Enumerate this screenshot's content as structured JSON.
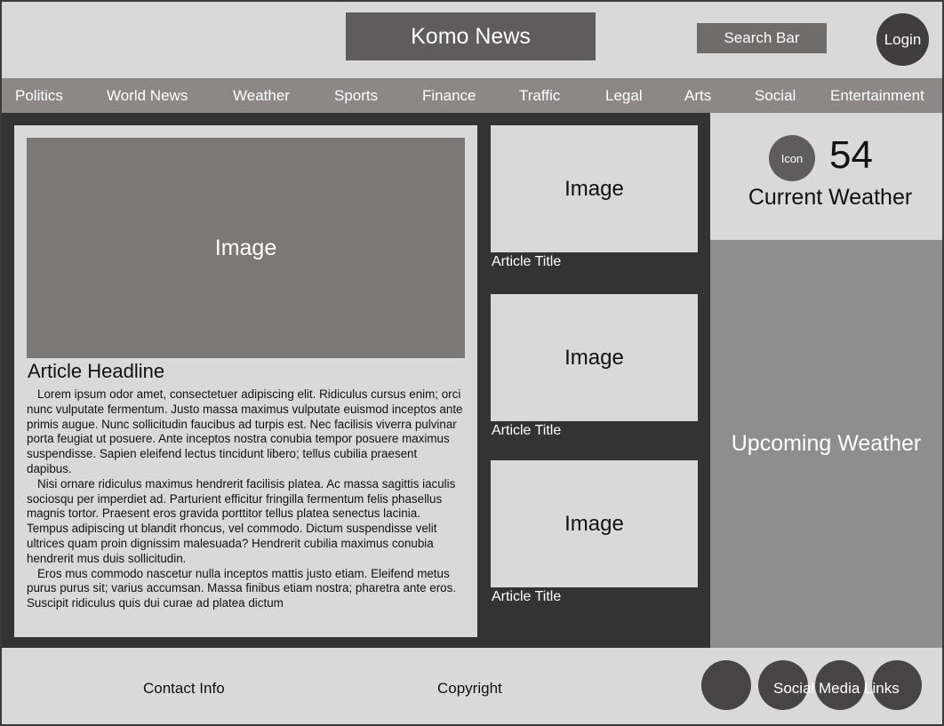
{
  "header": {
    "site_title": "Komo News",
    "search_label": "Search Bar",
    "login_label": "Login"
  },
  "nav": {
    "items": [
      {
        "label": "Politics"
      },
      {
        "label": "World News"
      },
      {
        "label": "Weather"
      },
      {
        "label": "Sports"
      },
      {
        "label": "Finance"
      },
      {
        "label": "Traffic"
      },
      {
        "label": "Legal"
      },
      {
        "label": "Arts"
      },
      {
        "label": "Social"
      },
      {
        "label": "Entertainment"
      }
    ]
  },
  "featured": {
    "image_label": "Image",
    "headline": "Article Headline",
    "paragraphs": [
      "Lorem ipsum odor amet, consectetuer adipiscing elit. Ridiculus cursus enim; orci nunc vulputate fermentum. Justo massa maximus vulputate euismod inceptos ante primis augue. Nunc sollicitudin faucibus ad turpis est. Nec facilisis viverra pulvinar porta feugiat ut posuere. Ante inceptos nostra conubia tempor posuere maximus suspendisse. Sapien eleifend lectus tincidunt libero; tellus cubilia praesent dapibus.",
      "Nisi ornare ridiculus maximus hendrerit facilisis platea. Ac massa sagittis iaculis sociosqu per imperdiet ad. Parturient efficitur fringilla fermentum felis phasellus magnis tortor. Praesent eros gravida porttitor tellus platea senectus lacinia. Tempus adipiscing ut blandit rhoncus, vel commodo. Dictum suspendisse velit ultrices quam proin dignissim malesuada? Hendrerit cubilia maximus conubia hendrerit mus duis sollicitudin.",
      "Eros mus commodo nascetur nulla inceptos mattis justo etiam. Eleifend metus purus purus sit; varius accumsan. Massa finibus etiam nostra; pharetra ante eros. Suscipit ridiculus quis dui curae ad platea dictum"
    ]
  },
  "articles": [
    {
      "image_label": "Image",
      "title": "Article Title"
    },
    {
      "image_label": "Image",
      "title": "Article Title"
    },
    {
      "image_label": "Image",
      "title": "Article Title"
    }
  ],
  "weather": {
    "icon_label": "Icon",
    "temperature": "54",
    "current_label": "Current Weather",
    "upcoming_label": "Upcoming Weather"
  },
  "footer": {
    "contact_label": "Contact Info",
    "copyright_label": "Copyright",
    "social_label": "Social Media Links"
  },
  "colors": {
    "page_bg": "#d9d9d9",
    "title_block": "#5e5c5c",
    "nav_bg": "#8c8888",
    "main_bg": "#333333",
    "upcoming_bg": "#8e8e8e"
  }
}
